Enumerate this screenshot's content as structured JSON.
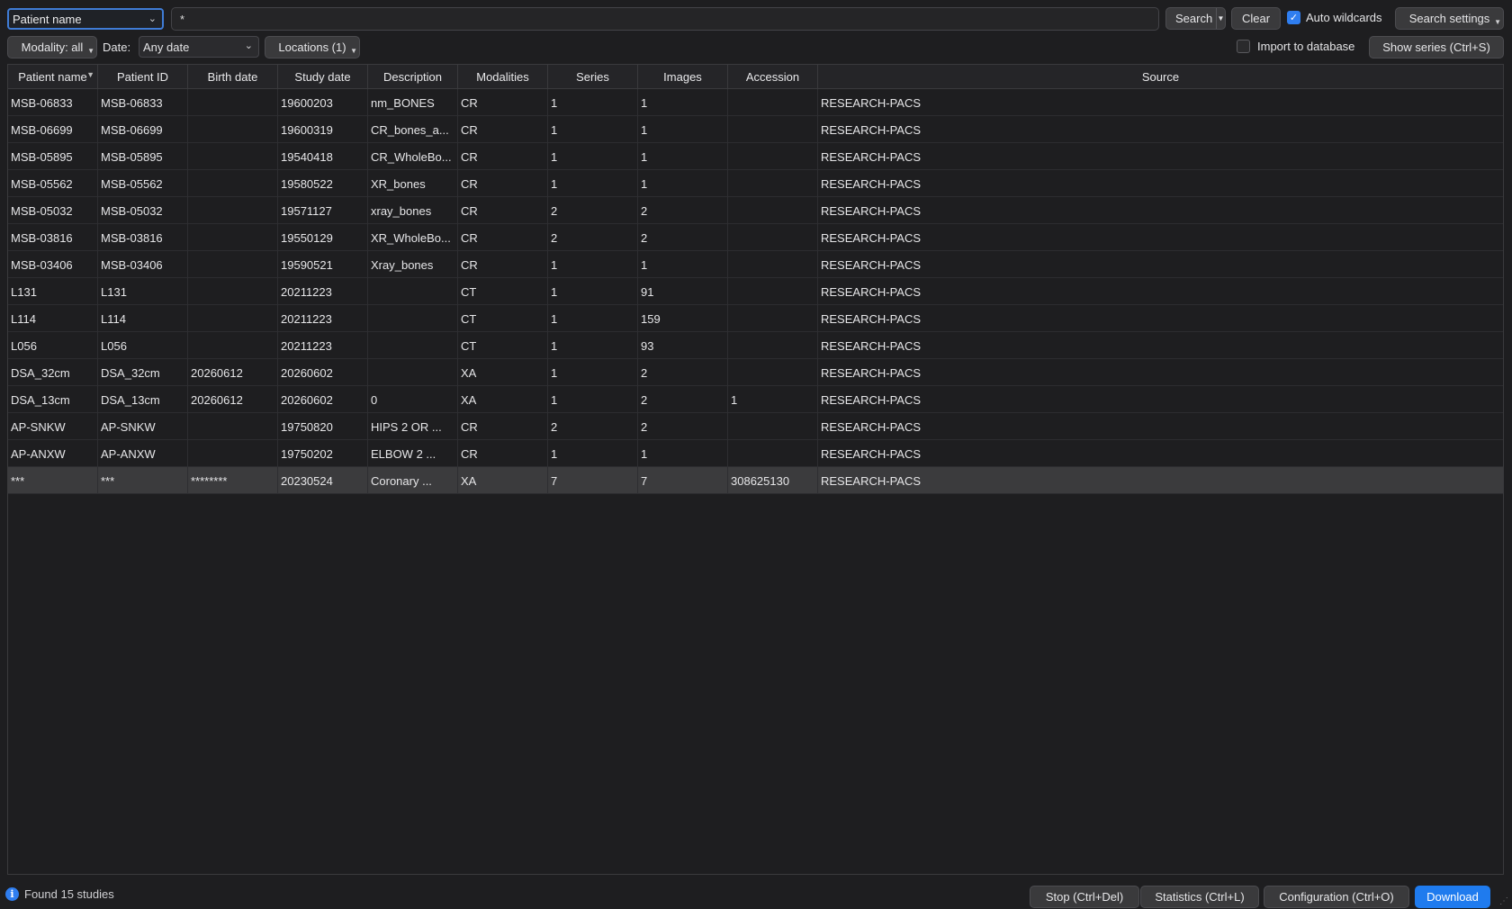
{
  "toolbar": {
    "field_select": "Patient name",
    "search_value": "*",
    "search_label": "Search",
    "clear_label": "Clear",
    "auto_wildcards_label": "Auto wildcards",
    "auto_wildcards_checked": true,
    "search_settings_label": "Search settings",
    "modality_label": "Modality: all",
    "date_label": "Date:",
    "date_value": "Any date",
    "locations_label": "Locations (1)",
    "import_label": "Import to database",
    "import_checked": false,
    "show_series_label": "Show series (Ctrl+S)"
  },
  "table": {
    "columns": [
      "Patient name",
      "Patient ID",
      "Birth date",
      "Study date",
      "Description",
      "Modalities",
      "Series",
      "Images",
      "Accession",
      "Source"
    ],
    "sorted_column": "Patient name",
    "selected_row": 14,
    "rows": [
      [
        "MSB-06833",
        "MSB-06833",
        "",
        "19600203",
        "nm_BONES",
        "CR",
        "1",
        "1",
        "",
        "RESEARCH-PACS"
      ],
      [
        "MSB-06699",
        "MSB-06699",
        "",
        "19600319",
        "CR_bones_a...",
        "CR",
        "1",
        "1",
        "",
        "RESEARCH-PACS"
      ],
      [
        "MSB-05895",
        "MSB-05895",
        "",
        "19540418",
        "CR_WholeBo...",
        "CR",
        "1",
        "1",
        "",
        "RESEARCH-PACS"
      ],
      [
        "MSB-05562",
        "MSB-05562",
        "",
        "19580522",
        "XR_bones",
        "CR",
        "1",
        "1",
        "",
        "RESEARCH-PACS"
      ],
      [
        "MSB-05032",
        "MSB-05032",
        "",
        "19571127",
        "xray_bones",
        "CR",
        "2",
        "2",
        "",
        "RESEARCH-PACS"
      ],
      [
        "MSB-03816",
        "MSB-03816",
        "",
        "19550129",
        "XR_WholeBo...",
        "CR",
        "2",
        "2",
        "",
        "RESEARCH-PACS"
      ],
      [
        "MSB-03406",
        "MSB-03406",
        "",
        "19590521",
        "Xray_bones",
        "CR",
        "1",
        "1",
        "",
        "RESEARCH-PACS"
      ],
      [
        "L131",
        "L131",
        "",
        "20211223",
        "",
        "CT",
        "1",
        "91",
        "",
        "RESEARCH-PACS"
      ],
      [
        "L114",
        "L114",
        "",
        "20211223",
        "",
        "CT",
        "1",
        "159",
        "",
        "RESEARCH-PACS"
      ],
      [
        "L056",
        "L056",
        "",
        "20211223",
        "",
        "CT",
        "1",
        "93",
        "",
        "RESEARCH-PACS"
      ],
      [
        "DSA_32cm",
        "DSA_32cm",
        "20260612",
        "20260602",
        "",
        "XA",
        "1",
        "2",
        "",
        "RESEARCH-PACS"
      ],
      [
        "DSA_13cm",
        "DSA_13cm",
        "20260612",
        "20260602",
        "0",
        "XA",
        "1",
        "2",
        "1",
        "RESEARCH-PACS"
      ],
      [
        "AP-SNKW",
        "AP-SNKW",
        "",
        "19750820",
        "HIPS 2 OR ...",
        "CR",
        "2",
        "2",
        "",
        "RESEARCH-PACS"
      ],
      [
        "AP-ANXW",
        "AP-ANXW",
        "",
        "19750202",
        "ELBOW 2 ...",
        "CR",
        "1",
        "1",
        "",
        "RESEARCH-PACS"
      ],
      [
        "***",
        "***",
        "********",
        "20230524",
        "Coronary ...",
        "XA",
        "7",
        "7",
        "308625130",
        "RESEARCH-PACS"
      ]
    ]
  },
  "statusbar": {
    "message": "Found 15 studies",
    "stop_label": "Stop (Ctrl+Del)",
    "statistics_label": "Statistics (Ctrl+L)",
    "configuration_label": "Configuration (Ctrl+O)",
    "download_label": "Download"
  }
}
